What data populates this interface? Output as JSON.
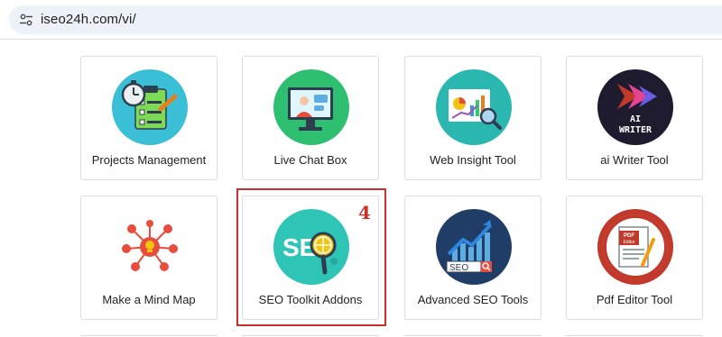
{
  "browser": {
    "url": "iseo24h.com/vi/",
    "site_info_icon": "tune-icon"
  },
  "cards": [
    {
      "label": "Projects Management",
      "icon": "clipboard-stopwatch-icon",
      "bg": "#3bbfd6"
    },
    {
      "label": "Live Chat Box",
      "icon": "monitor-agent-icon",
      "bg": "#2fbf71"
    },
    {
      "label": "Web Insight Tool",
      "icon": "analytics-magnifier-icon",
      "bg": "#2ab7b0"
    },
    {
      "label": "ai Writer Tool",
      "icon": "ai-writer-logo-icon",
      "bg": "#1e1b2e"
    },
    {
      "label": "Make a Mind Map",
      "icon": "mind-map-bulb-icon",
      "bg": "#ffffff"
    },
    {
      "label": "SEO Toolkit Addons",
      "icon": "seo-globe-magnifier-icon",
      "bg": "#2ec4b6"
    },
    {
      "label": "Advanced SEO Tools",
      "icon": "seo-growth-chart-icon",
      "bg": "#1f3d66"
    },
    {
      "label": "Pdf Editor Tool",
      "icon": "pdf-editor-icon",
      "bg": "#c0392b"
    }
  ],
  "annotation": {
    "step_number": "4",
    "color": "#c9302c"
  },
  "ai_writer_text": {
    "line1": "AI",
    "line2": "WRITER"
  },
  "seo_text": "SE",
  "seo_small_text": "SEO",
  "pdf_text": {
    "line1": "PDF",
    "line2": "Editor"
  }
}
